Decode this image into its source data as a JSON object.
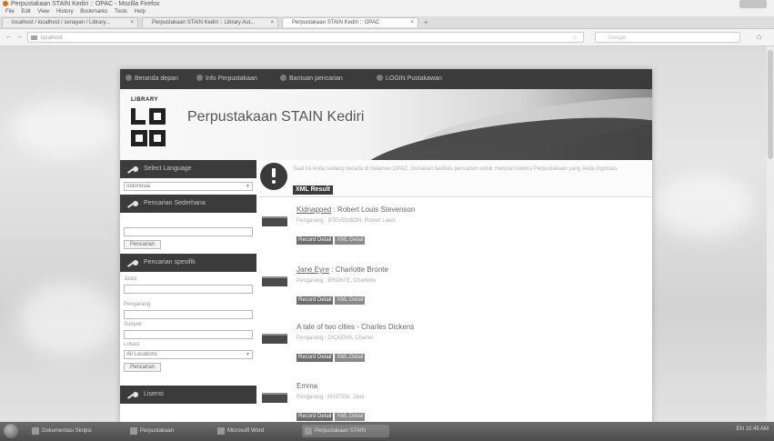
{
  "window": {
    "title": "Perpustakaan STAIN Kediri :: OPAC - Mozilla Firefox"
  },
  "menu": [
    "File",
    "Edit",
    "View",
    "History",
    "Bookmarks",
    "Tools",
    "Help"
  ],
  "tabs": [
    {
      "label": "localhost / localhost / senayan / Library..."
    },
    {
      "label": "Perpustakaan STAIN Kediri :: Library Aut..."
    },
    {
      "label": "Perpustakaan STAIN Kediri :: OPAC"
    }
  ],
  "address": {
    "url": "localhost",
    "search_placeholder": "Google"
  },
  "site": {
    "nav": [
      "Beranda depan",
      "Info Perpustakaan",
      "Bantuan pencarian",
      "LOGIN Pustakawan"
    ],
    "logo_small": "LIBRARY",
    "logo_big": "LOGO",
    "title": "Perpustakaan STAIN Kediri"
  },
  "sidebar": {
    "language_header": "Select Language",
    "language_value": "Indonesia",
    "simple_header": "Pencarian Sederhana",
    "search_button": "Pencarian",
    "specific_header": "Pencarian spesifik",
    "title_label": "Judul",
    "author_label": "Pengarang",
    "subject_label": "Subyek",
    "location_label": "Lokasi",
    "location_value": "All Locations",
    "search_button2": "Pencarian",
    "license_header": "Lisensi"
  },
  "info": {
    "text": "Saat ini Anda sedang berada di halaman OPAC. Gunakan fasilitas pencarian untuk mencari koleksi Perpustakaan yang Anda inginkan.",
    "xml_button": "XML Result"
  },
  "results": [
    {
      "title": "Kidnapped",
      "author": "Robert Louis Stevenson",
      "byline": "Pengarang : STEVENSON, Robert Louis"
    },
    {
      "title": "Jane Eyre",
      "author": "Charlotte Bronte",
      "byline": "Pengarang : BRONTE, Charlotte"
    },
    {
      "title": "A tale of two cities",
      "author": "Charles Dickens",
      "byline": "Pengarang : DICKENS, Charles"
    },
    {
      "title": "Emma",
      "author": "",
      "byline": "Pengarang : AUSTEN, Jane"
    }
  ],
  "result_buttons": {
    "detail": "Record Detail",
    "xml": "XML Detail"
  },
  "taskbar": {
    "items": [
      "Dokumentasi Skripsi",
      "Perpustakaan",
      "Microsoft Word",
      "Perpustakaan STAIN"
    ],
    "tray": "EN  10:45 AM"
  },
  "colors": {
    "header_dark": "#3b3b3b",
    "accent": "#6e6e6e"
  }
}
